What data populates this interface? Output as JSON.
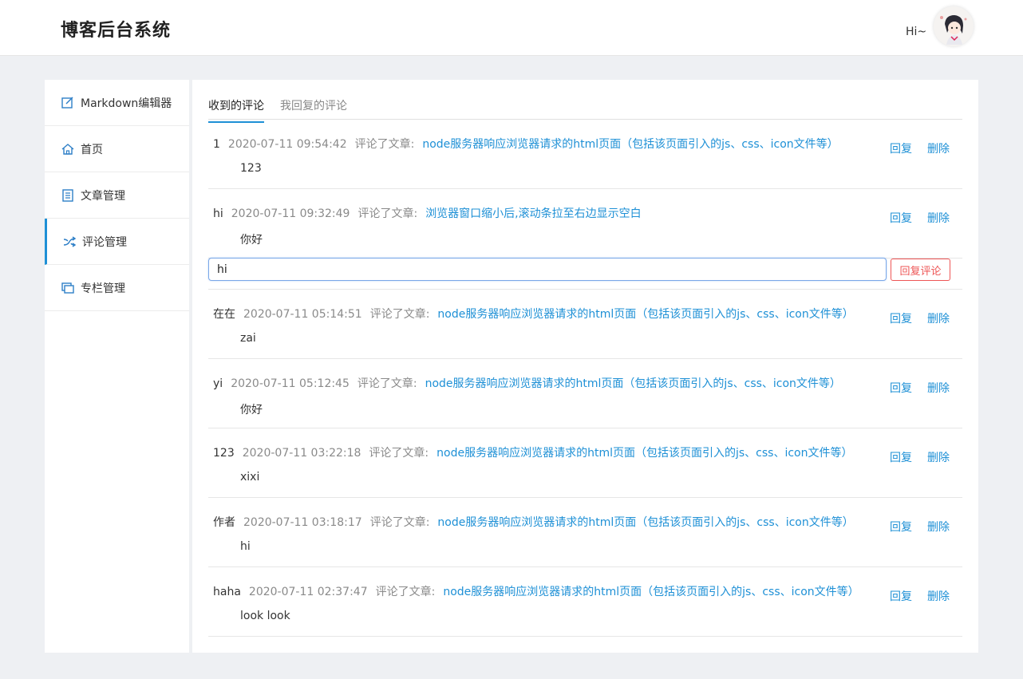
{
  "header": {
    "title": "博客后台系统",
    "greeting": "Hi~",
    "avatar_icon": "user-avatar-icon"
  },
  "sidebar": {
    "items": [
      {
        "label": "Markdown编辑器",
        "icon": "edit-icon"
      },
      {
        "label": "首页",
        "icon": "home-icon"
      },
      {
        "label": "文章管理",
        "icon": "list-icon"
      },
      {
        "label": "评论管理",
        "icon": "shuffle-icon",
        "active": true
      },
      {
        "label": "专栏管理",
        "icon": "columns-icon"
      }
    ]
  },
  "tabs": [
    {
      "label": "收到的评论",
      "active": true
    },
    {
      "label": "我回复的评论",
      "active": false
    }
  ],
  "actions": {
    "reply": "回复",
    "delete": "删除"
  },
  "comments": [
    {
      "author": "1",
      "time": "2020-07-11 09:54:42",
      "verb": "评论了文章:",
      "article": "node服务器响应浏览器请求的html页面（包括该页面引入的js、css、icon文件等）",
      "content": "123"
    },
    {
      "author": "hi",
      "time": "2020-07-11 09:32:49",
      "verb": "评论了文章:",
      "article": "浏览器窗口缩小后,滚动条拉至右边显示空白",
      "content": "你好"
    },
    {
      "author": "在在",
      "time": "2020-07-11 05:14:51",
      "verb": "评论了文章:",
      "article": "node服务器响应浏览器请求的html页面（包括该页面引入的js、css、icon文件等）",
      "content": "zai"
    },
    {
      "author": "yi",
      "time": "2020-07-11 05:12:45",
      "verb": "评论了文章:",
      "article": "node服务器响应浏览器请求的html页面（包括该页面引入的js、css、icon文件等）",
      "content": "你好"
    },
    {
      "author": "123",
      "time": "2020-07-11 03:22:18",
      "verb": "评论了文章:",
      "article": "node服务器响应浏览器请求的html页面（包括该页面引入的js、css、icon文件等）",
      "content": "xixi"
    },
    {
      "author": "作者",
      "time": "2020-07-11 03:18:17",
      "verb": "评论了文章:",
      "article": "node服务器响应浏览器请求的html页面（包括该页面引入的js、css、icon文件等）",
      "content": "hi"
    },
    {
      "author": "haha",
      "time": "2020-07-11 02:37:47",
      "verb": "评论了文章:",
      "article": "node服务器响应浏览器请求的html页面（包括该页面引入的js、css、icon文件等）",
      "content": "look look"
    }
  ],
  "reply_box": {
    "value": "hi",
    "submit_label": "回复评论"
  },
  "colors": {
    "accent": "#1e90d6",
    "danger": "#e55555",
    "background": "#eef0f3"
  }
}
